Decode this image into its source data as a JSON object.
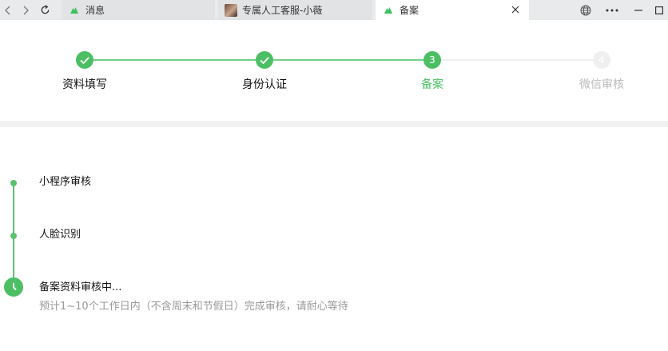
{
  "browser": {
    "tabs": [
      {
        "label": "消息",
        "favicon": "mini-program-icon",
        "active": false
      },
      {
        "label": "专属人工客服-小薇",
        "favicon": "avatar",
        "active": false
      },
      {
        "label": "备案",
        "favicon": "mini-program-icon",
        "active": true
      }
    ]
  },
  "steps": {
    "items": [
      {
        "label": "资料填写",
        "state": "done"
      },
      {
        "label": "身份认证",
        "state": "done"
      },
      {
        "label": "备案",
        "number": "3",
        "state": "current"
      },
      {
        "label": "微信审核",
        "number": "4",
        "state": "pending"
      }
    ]
  },
  "timeline": {
    "items": [
      {
        "title": "小程序审核",
        "state": "done"
      },
      {
        "title": "人脸识别",
        "state": "done"
      },
      {
        "title": "备案资料审核中...",
        "description": "预计1~10个工作日内（不含周末和节假日）完成审核，请耐心等待",
        "state": "in-progress"
      }
    ]
  },
  "colors": {
    "accent": "#4cbf65",
    "pending": "#e8e8e8",
    "pending_text": "#bbbbbb",
    "muted_text": "#999999"
  }
}
